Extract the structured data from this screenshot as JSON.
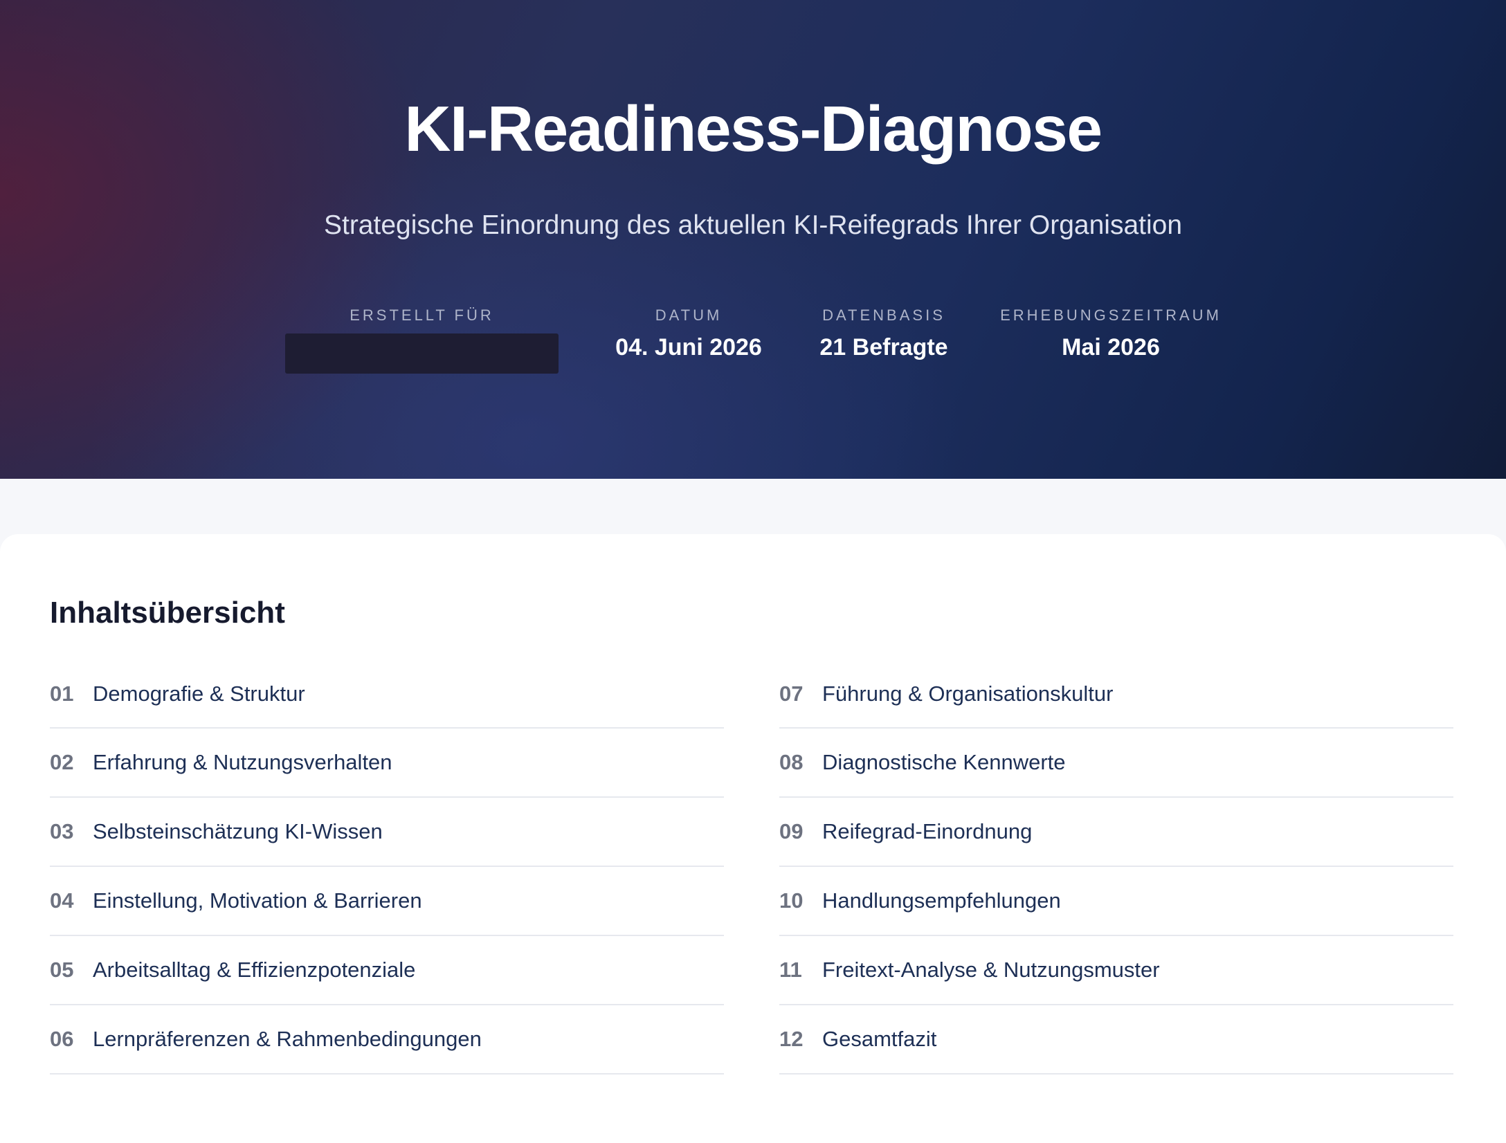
{
  "hero": {
    "title": "KI-Readiness-Diagnose",
    "subtitle": "Strategische Einordnung des aktuellen KI-Reifegrads Ihrer Organisation",
    "meta": [
      {
        "label": "ERSTELLT FÜR",
        "value": ""
      },
      {
        "label": "DATUM",
        "value": "04. Juni 2026"
      },
      {
        "label": "DATENBASIS",
        "value": "21 Befragte"
      },
      {
        "label": "ERHEBUNGSZEITRAUM",
        "value": "Mai 2026"
      }
    ]
  },
  "toc": {
    "title": "Inhaltsübersicht",
    "left": [
      {
        "num": "01",
        "label": "Demografie & Struktur"
      },
      {
        "num": "02",
        "label": "Erfahrung & Nutzungsverhalten"
      },
      {
        "num": "03",
        "label": "Selbsteinschätzung KI-Wissen"
      },
      {
        "num": "04",
        "label": "Einstellung, Motivation & Barrieren"
      },
      {
        "num": "05",
        "label": "Arbeitsalltag & Effizienzpotenziale"
      },
      {
        "num": "06",
        "label": "Lernpräferenzen & Rahmenbedingungen"
      }
    ],
    "right": [
      {
        "num": "07",
        "label": "Führung & Organisationskultur"
      },
      {
        "num": "08",
        "label": "Diagnostische Kennwerte"
      },
      {
        "num": "09",
        "label": "Reifegrad-Einordnung"
      },
      {
        "num": "10",
        "label": "Handlungsempfehlungen"
      },
      {
        "num": "11",
        "label": "Freitext-Analyse & Nutzungsmuster"
      },
      {
        "num": "12",
        "label": "Gesamtfazit"
      }
    ]
  }
}
